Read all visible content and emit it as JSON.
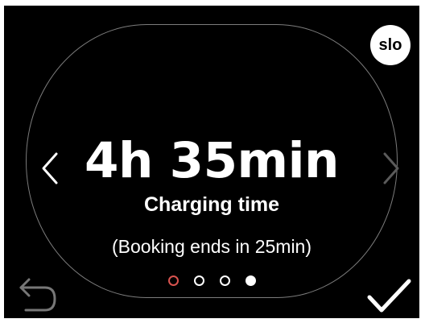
{
  "language": {
    "label": "slo"
  },
  "charging": {
    "value": "4h 35min",
    "label": "Charging time",
    "note": "(Booking ends in 25min)"
  },
  "pager": {
    "total": 4,
    "active_index": 3,
    "current_color": "#d9534f"
  },
  "icons": {
    "prev": "chevron-left-icon",
    "next": "chevron-right-icon",
    "back": "back-arrow-icon",
    "confirm": "checkmark-icon"
  },
  "colors": {
    "screen_bg": "#000000",
    "text": "#ffffff",
    "oval_border": "#7c7c7c",
    "disabled_arrow": "#5a5a5a",
    "back_icon": "#777777"
  }
}
